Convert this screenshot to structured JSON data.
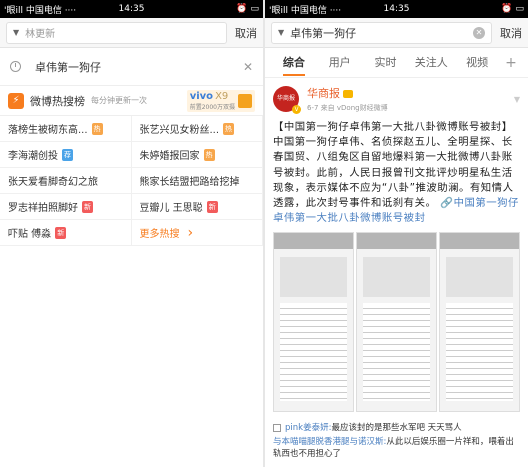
{
  "left": {
    "status": {
      "left": "'眼ill 中国电信 ····",
      "time": "14:35",
      "right": "⏰ ▭"
    },
    "search": {
      "placeholder": "林更新",
      "cancel": "取消"
    },
    "history": {
      "item": "卓伟第一狗仔"
    },
    "hot": {
      "logo": "⚡",
      "title": "微博热搜榜",
      "sub": "每分钟更新一次",
      "ad": {
        "brand": "vivo",
        "model": "X9",
        "sub": "前置2000万双摄"
      },
      "items": [
        {
          "text": "落榜生被砌东高...",
          "tag": "热",
          "tagtype": "hot"
        },
        {
          "text": "张艺兴见女粉丝...",
          "tag": "热",
          "tagtype": "hot"
        },
        {
          "text": "李海潮创投",
          "tag": "荐",
          "tagtype": "rec"
        },
        {
          "text": "朱婷婚报回家",
          "tag": "热",
          "tagtype": "hot"
        },
        {
          "text": "张天爱看脚奇幻之旅",
          "tag": "",
          "tagtype": ""
        },
        {
          "text": "熊家长结盟把路给挖掉",
          "tag": "",
          "tagtype": ""
        },
        {
          "text": "罗志祥拍照脚好",
          "tag": "新",
          "tagtype": "new"
        },
        {
          "text": "豆瓣儿 王思聪",
          "tag": "新",
          "tagtype": "new"
        },
        {
          "text": "吓贴 傅淼",
          "tag": "新",
          "tagtype": "new"
        },
        {
          "text": "更多热搜",
          "tag": "",
          "tagtype": "more"
        }
      ]
    }
  },
  "right": {
    "status": {
      "left": "'眼ill 中国电信 ····",
      "time": "14:35",
      "right": "⏰ ▭"
    },
    "search": {
      "value": "卓伟第一狗仔",
      "cancel": "取消"
    },
    "tabs": [
      "综合",
      "用户",
      "实时",
      "关注人",
      "视频",
      "+"
    ],
    "post": {
      "avatar": "华商报",
      "name": "华商报",
      "meta": "6-7 来自 vDong财经微博",
      "body": "【中国第一狗仔卓伟第一大批八卦微博账号被封】中国第一狗仔卓伟、名侦探赵五儿、全明星探、长春国贸、八组兔区自留地爆料第一大批微博八卦账号被封。此前，人民日报曾刊文批评炒明星私生活现象，表示媒体不应为“八卦”推波助澜。有知情人透露，此次封号事件和诋刹有关。",
      "link": "🔗中国第一狗仔卓伟第一大批八卦微博账号被封"
    },
    "comments": [
      {
        "user": "pink姜泰妍:",
        "text": "最应该封的是那些水军吧 天天骂人"
      },
      {
        "user": "与本喵喵腿脱香港腿与诺汉斯:",
        "text": "从此以后娱乐圈一片祥和，喂着出轨西也不用担心了"
      }
    ]
  }
}
